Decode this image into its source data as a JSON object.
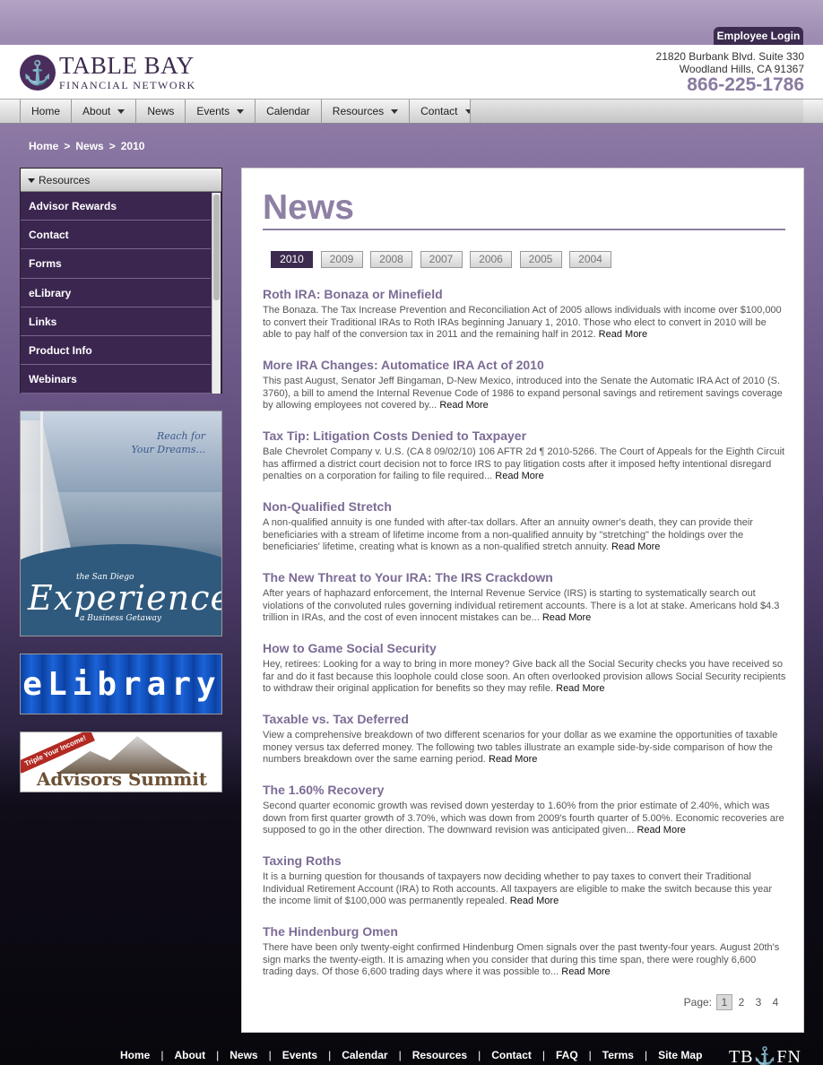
{
  "header": {
    "employee_login": "Employee Login",
    "logo_mark": "⚓",
    "logo_line1": "TABLE BAY",
    "logo_line2": "FINANCIAL NETWORK",
    "address_line1": "21820 Burbank Blvd. Suite 330",
    "address_line2": "Woodland Hills, CA 91367",
    "phone": "866-225-1786"
  },
  "nav": {
    "items": [
      {
        "label": "Home",
        "dropdown": false
      },
      {
        "label": "About",
        "dropdown": true
      },
      {
        "label": "News",
        "dropdown": false
      },
      {
        "label": "Events",
        "dropdown": true
      },
      {
        "label": "Calendar",
        "dropdown": false
      },
      {
        "label": "Resources",
        "dropdown": true
      },
      {
        "label": "Contact",
        "dropdown": true
      }
    ]
  },
  "breadcrumb": {
    "home": "Home",
    "news": "News",
    "year": "2010",
    "sep": ">"
  },
  "sidebar": {
    "heading": "Resources",
    "items": [
      "Advisor Rewards",
      "Contact",
      "Forms",
      "eLibrary",
      "Links",
      "Product Info",
      "Webinars"
    ]
  },
  "banners": {
    "experience": {
      "reach_line1": "Reach for",
      "reach_line2": "Your Dreams...",
      "the_sd": "the San Diego",
      "title": "Experience",
      "subtitle": "a Business Getaway"
    },
    "elibrary": {
      "title": "eLibrary"
    },
    "summit": {
      "ribbon": "Triple Your Income!",
      "title": "Advisors Summit"
    }
  },
  "main": {
    "title": "News",
    "years": [
      "2010",
      "2009",
      "2008",
      "2007",
      "2006",
      "2005",
      "2004"
    ],
    "active_year": "2010",
    "read_more": "Read More",
    "articles": [
      {
        "title": "Roth IRA: Bonaza or Minefield",
        "body": "The Bonaza. The Tax Increase Prevention and Reconciliation Act of 2005 allows individuals with income over $100,000 to convert their Traditional IRAs to Roth IRAs beginning January 1, 2010. Those who elect to convert in 2010 will be able to pay half of the conversion tax in 2011 and the remaining half in 2012."
      },
      {
        "title": "More IRA Changes: Automatice IRA Act of 2010",
        "body": "This past August, Senator Jeff Bingaman, D-New Mexico, introduced into the Senate the Automatic IRA Act of 2010 (S. 3760), a bill to amend the Internal Revenue Code of 1986 to expand personal savings and retirement savings coverage by allowing employees not covered by..."
      },
      {
        "title": "Tax Tip: Litigation Costs Denied to Taxpayer",
        "body": "Bale Chevrolet Company v. U.S. (CA 8 09/02/10) 106 AFTR 2d ¶ 2010-5266. The Court of Appeals for the Eighth Circuit has affirmed a district court decision not to force IRS to pay litigation costs after it imposed hefty intentional disregard penalties on a corporation for failing to file required..."
      },
      {
        "title": "Non-Qualified Stretch",
        "body": "A non-qualified annuity is one funded with after-tax dollars. After an annuity owner's death, they can provide their beneficiaries with a stream of lifetime income from a non-qualified annuity by \"stretching\" the holdings over the beneficiaries' lifetime, creating what is known as a non-qualified stretch annuity."
      },
      {
        "title": "The New Threat to Your IRA: The IRS Crackdown",
        "body": "After years of haphazard enforcement, the Internal Revenue Service (IRS) is starting to systematically search out violations of the convoluted rules governing individual retirement accounts. There is a lot at stake. Americans hold $4.3 trillion in IRAs, and the cost of even innocent mistakes can be..."
      },
      {
        "title": "How to Game Social Security",
        "body": "Hey, retirees: Looking for a way to bring in more money? Give back all the Social Security checks you have received so far and do it fast because this loophole could close soon. An often overlooked provision allows Social Security recipients to withdraw their original application for benefits so they may refile."
      },
      {
        "title": "Taxable vs. Tax Deferred",
        "body": "View a comprehensive breakdown of two different scenarios for your dollar as we examine the opportunities of taxable money versus tax deferred money. The following two tables illustrate an example side-by-side comparison of how the numbers breakdown over the same earning period."
      },
      {
        "title": "The 1.60% Recovery",
        "body": "Second quarter economic growth was revised down yesterday to 1.60% from the prior estimate of 2.40%, which was down from first quarter growth of 3.70%, which was down from 2009's fourth quarter of 5.00%. Economic recoveries are supposed to go in the other direction. The downward revision was anticipated given..."
      },
      {
        "title": "Taxing Roths",
        "body": "It is a burning question for thousands of taxpayers now deciding whether to pay taxes to convert their Traditional Individual Retirement Account (IRA) to Roth accounts. All taxpayers are eligible to make the switch because this year the income limit of $100,000 was permanently repealed."
      },
      {
        "title": "The Hindenburg Omen",
        "body": "There have been only twenty-eight confirmed Hindenburg Omen signals over the past twenty-four years. August 20th's sign marks the twenty-eigth. It is amazing when you consider that during this time span, there were roughly 6,600 trading days. Of those 6,600 trading days where it was possible to..."
      }
    ],
    "pager": {
      "label": "Page:",
      "pages": [
        "1",
        "2",
        "3",
        "4"
      ],
      "current": "1"
    }
  },
  "footer": {
    "links": [
      "Home",
      "About",
      "News",
      "Events",
      "Calendar",
      "Resources",
      "Contact",
      "FAQ",
      "Terms",
      "Site Map"
    ],
    "sep": "|",
    "logo": "TB⚓FN"
  }
}
